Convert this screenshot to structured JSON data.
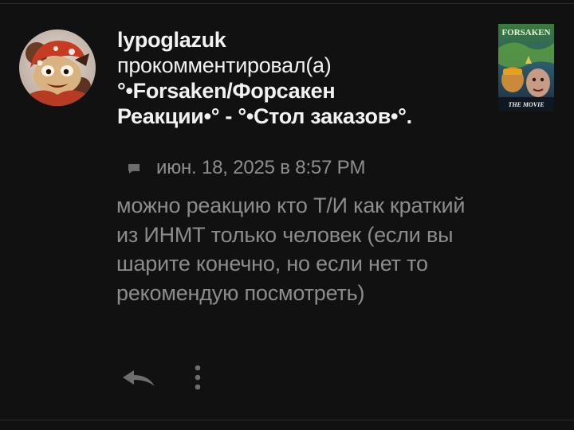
{
  "notification": {
    "author": "lypoglazuk",
    "action": "прокомментировал(а)",
    "post_title_line1": "°•Forsaken/Форсакен",
    "post_title_line2": "Реакции•° - °•Стол заказов•°.",
    "timestamp": "июн. 18, 2025 в 8:57 PM",
    "comment_text": "можно реакцию кто Т/И как краткий из ИНМТ только человек (если вы шарите конечно, но если нет то рекомендую посмотреть)"
  },
  "thumbnail": {
    "title_text": "FORSAKEN",
    "subtitle_text": "THE MOVIE"
  },
  "icons": {
    "comment": "comment-bubble-icon",
    "reply": "reply-arrow-icon",
    "more": "vertical-ellipsis-icon"
  },
  "colors": {
    "background": "#121112",
    "primary_text": "#f2f2f2",
    "secondary_text": "#8d8c8d",
    "icon": "#6e6d6e"
  }
}
